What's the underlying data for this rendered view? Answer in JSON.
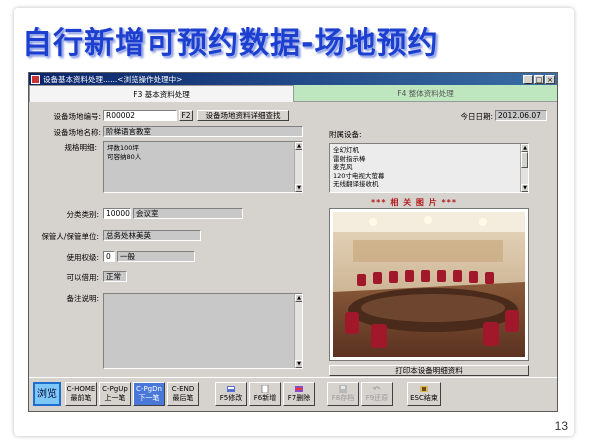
{
  "slide": {
    "title": "自行新增可预约数据-场地预约",
    "page_number": "13"
  },
  "window": {
    "title": "设备基本资料处理......<浏览操作处理中>",
    "controls": [
      "_",
      "□",
      "×"
    ]
  },
  "tabs": [
    {
      "label": "F3 基本资料处理",
      "active": true
    },
    {
      "label": "F4 整体资料处理",
      "active": false
    }
  ],
  "form": {
    "venue_code_label": "设备场地编号:",
    "venue_code_value": "R00002",
    "f2_label": "F2",
    "lookup_button": "设备场地资料详细查找",
    "today_label": "今日日期:",
    "today_value": "2012.06.07",
    "venue_name_label": "设备场地名称:",
    "venue_name_value": "阶梯语言教室",
    "spec_label": "规格明细:",
    "spec_lines": [
      "坪数100坪",
      "可容纳80人"
    ],
    "equipment_label": "附属设备:",
    "equipment_items": [
      "全幻灯机",
      "雷射指示棒",
      "麦克风",
      "120寸电视大萤幕",
      "无线翻译接收机"
    ],
    "category_label": "分类类别:",
    "category_code": "10000",
    "category_name": "会议室",
    "custodian_label": "保管人/保管单位:",
    "custodian_value": "总务处林美英",
    "permission_label": "使用权级:",
    "permission_code": "0",
    "permission_name": "一般",
    "borrowable_label": "可以借用:",
    "borrowable_value": "正常",
    "notes_label": "备注说明:",
    "notes_value": ""
  },
  "photo": {
    "heading": "***   相 关 图 片   ***",
    "print_button": "打印本设备明细资料"
  },
  "toolbar": {
    "browse": "浏览",
    "home": {
      "line1": "C-HOME",
      "line2": "最前笔"
    },
    "pageup": {
      "line1": "C-PgUp",
      "line2": "上一笔"
    },
    "pagedown": {
      "line1": "C-PgDn",
      "line2": "下一笔"
    },
    "end": {
      "line1": "C-END",
      "line2": "最后笔"
    },
    "edit": "F5修改",
    "add": "F6新增",
    "delete": "F7删除",
    "save": "F8存档",
    "cancel": "F9还原",
    "exit": "ESC结束"
  },
  "colors": {
    "title_blue": "#1d3fd0",
    "titlebar_navy": "#0a246a",
    "inactive_tab_green": "#bfe7bf",
    "photo_heading_red": "#b21d1d",
    "browse_blue": "#7ec8f8"
  },
  "icons": [
    "app-icon",
    "edit-icon",
    "add-icon",
    "delete-icon",
    "save-icon",
    "cancel-icon",
    "exit-icon"
  ]
}
